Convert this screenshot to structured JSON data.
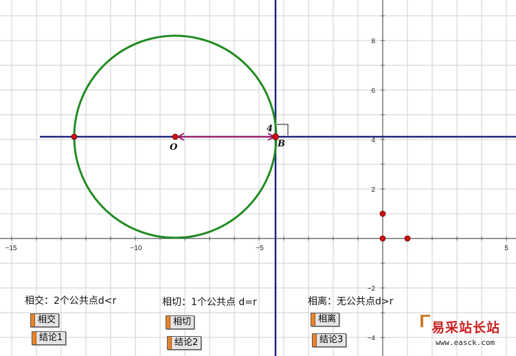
{
  "axes": {
    "x_ticks": [
      "−15",
      "−10",
      "−5",
      "5"
    ],
    "y_ticks": [
      "8",
      "6",
      "4",
      "2",
      "−2",
      "−4"
    ]
  },
  "points": {
    "center_label": "O",
    "tangent_label": "B",
    "tangent_secondary_label": "4"
  },
  "cases": [
    {
      "text": "相交：2个公共点d<r",
      "button1": "相交",
      "button2": "结论1"
    },
    {
      "text": "相切：1个公共点 d=r",
      "button1": "相切",
      "button2": "结论2"
    },
    {
      "text": "相离：无公共点d>r",
      "button1": "相离",
      "button2": "结论3"
    }
  ],
  "watermark": {
    "text": "易采站长站",
    "url": "www.easck.com"
  },
  "colors": {
    "grid": "#cfcfcf",
    "axis": "#555555",
    "line": "#1a237e",
    "circle": "#228b22",
    "segment": "#a0206a",
    "point": "#cc1010"
  }
}
